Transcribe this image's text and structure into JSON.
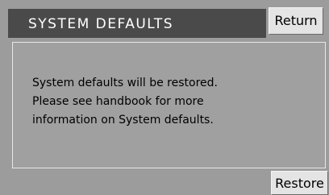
{
  "header": {
    "title": "SYSTEM DEFAULTS"
  },
  "buttons": {
    "return_label": "Return",
    "restore_label": "Restore"
  },
  "message": {
    "lines": [
      "System defaults will be restored.",
      "Please see handbook for more",
      "information on System defaults."
    ]
  },
  "colors": {
    "background": "#9c9c9c",
    "header_bar": "#4a4a4a",
    "button_face": "#e4e4e4",
    "panel_border": "#e8e8e8"
  }
}
